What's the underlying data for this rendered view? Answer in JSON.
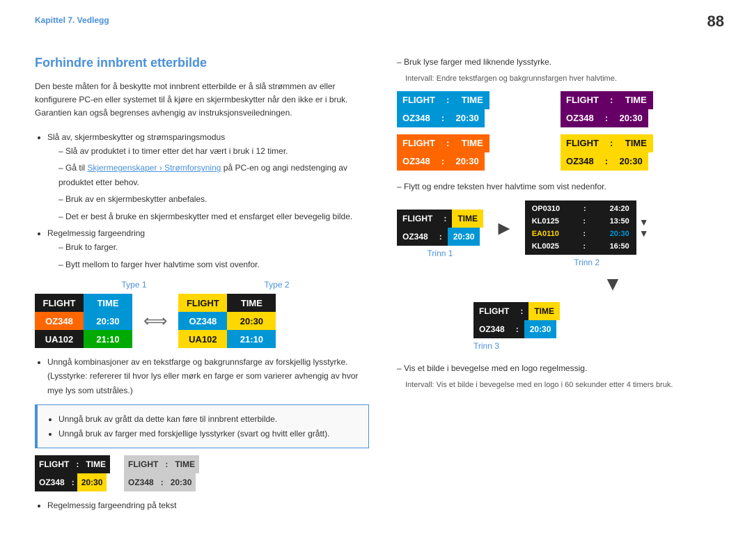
{
  "page": {
    "number": "88",
    "chapter": "Kapittel 7. Vedlegg"
  },
  "section": {
    "title": "Forhindre innbrent etterbilde",
    "intro": "Den beste måten for å beskytte mot innbrent etterbilde er å slå strømmen av eller konfigurere PC-en eller systemet til å kjøre en skjermbeskytter når den ikke er i bruk. Garantien kan også begrenses avhengig av instruksjonsveiledningen.",
    "bullets": [
      {
        "text": "Slå av, skjermbeskytter og strømsparingsmodus",
        "sub": [
          "Slå av produktet i to timer etter det har vært i bruk i 12 timer.",
          "Gå til Skjermegenskaper > Strømforsyning på PC-en og angi nedstenging av produktet etter behov.",
          "Bruk av en skjermbeskytter anbefales.",
          "Det er best å bruke en skjermbeskytter med et ensfarget eller bevegelig bilde."
        ]
      },
      {
        "text": "Regelmessig fargeendring",
        "sub": [
          "Bruk to farger.",
          "Bytt mellom to farger hver halvtime som vist ovenfor."
        ]
      }
    ],
    "type1_label": "Type 1",
    "type2_label": "Type 2",
    "board1": {
      "row1": [
        {
          "text": "FLIGHT",
          "cls": "c-black"
        },
        {
          "text": "TIME",
          "cls": "c-blue"
        }
      ],
      "row2": [
        {
          "text": "OZ348",
          "cls": "c-orange"
        },
        {
          "text": "20:30",
          "cls": "c-blue"
        }
      ],
      "row3": [
        {
          "text": "UA102",
          "cls": "c-black"
        },
        {
          "text": "21:10",
          "cls": "c-green"
        }
      ]
    },
    "board2": {
      "row1": [
        {
          "text": "FLIGHT",
          "cls": "c-yellow"
        },
        {
          "text": "TIME",
          "cls": "c-black"
        }
      ],
      "row2": [
        {
          "text": "OZ348",
          "cls": "c-blue"
        },
        {
          "text": "20:30",
          "cls": "c-yellow"
        }
      ],
      "row3": [
        {
          "text": "UA102",
          "cls": "c-yellow"
        },
        {
          "text": "21:10",
          "cls": "c-blue"
        }
      ]
    },
    "avoid_text": "Unngå kombinasjoner av en tekstfarge og bakgrunnsfarge av forskjellig lysstyrke. (Lysstyrke: refererer til hvor lys eller mørk en farge er som varierer avhengig av hvor mye lys som utstråles.)",
    "info_bullets": [
      "Unngå bruk av grått da dette kan føre til innbrent etterbilde.",
      "Unngå bruk av farger med forskjellige lysstyrker (svart og hvitt eller grått)."
    ],
    "bad1": {
      "label": "",
      "row1": [
        {
          "text": "FLIGHT",
          "cls": "c-black"
        },
        {
          "text": ":",
          "cls": "c-black"
        },
        {
          "text": "TIME",
          "cls": "c-black"
        }
      ],
      "row2": [
        {
          "text": "OZ348",
          "cls": "c-black"
        },
        {
          "text": ":",
          "cls": "c-black"
        },
        {
          "text": "20:30",
          "cls": "c-yellow"
        }
      ]
    },
    "bad2": {
      "label": "",
      "row1": [
        {
          "text": "FLIGHT",
          "cls": "c-lightgray"
        },
        {
          "text": ":",
          "cls": "c-lightgray"
        },
        {
          "text": "TIME",
          "cls": "c-lightgray"
        }
      ],
      "row2": [
        {
          "text": "OZ348",
          "cls": "c-lightgray"
        },
        {
          "text": ":",
          "cls": "c-lightgray"
        },
        {
          "text": "20:30",
          "cls": "c-lightgray"
        }
      ]
    },
    "bottom_bullet": "Regelmessig fargeendring på tekst"
  },
  "right": {
    "note1_dash": "Bruk lyse farger med liknende lysstyrke.",
    "note1_sub": "Intervall: Endre tekstfargen og bakgrunnsfargen hver halvtime.",
    "color_boards": [
      {
        "row1": [
          {
            "text": "FLIGHT",
            "cls": "c-blue"
          },
          {
            "text": ":",
            "cls": "c-blue"
          },
          {
            "text": "TIME",
            "cls": "c-blue"
          }
        ],
        "row2": [
          {
            "text": "OZ348",
            "cls": "c-blue"
          },
          {
            "text": ":",
            "cls": "c-blue"
          },
          {
            "text": "20:30",
            "cls": "c-blue"
          }
        ]
      },
      {
        "row1": [
          {
            "text": "FLIGHT",
            "cls": "c-purple"
          },
          {
            "text": ":",
            "cls": "c-purple"
          },
          {
            "text": "TIME",
            "cls": "c-purple"
          }
        ],
        "row2": [
          {
            "text": "OZ348",
            "cls": "c-purple"
          },
          {
            "text": ":",
            "cls": "c-purple"
          },
          {
            "text": "20:30",
            "cls": "c-purple"
          }
        ]
      },
      {
        "row1": [
          {
            "text": "FLIGHT",
            "cls": "c-orange"
          },
          {
            "text": ":",
            "cls": "c-orange"
          },
          {
            "text": "TIME",
            "cls": "c-orange"
          }
        ],
        "row2": [
          {
            "text": "OZ348",
            "cls": "c-orange"
          },
          {
            "text": ":",
            "cls": "c-orange"
          },
          {
            "text": "20:30",
            "cls": "c-orange"
          }
        ]
      },
      {
        "row1": [
          {
            "text": "FLIGHT",
            "cls": "c-yellow"
          },
          {
            "text": ":",
            "cls": "c-yellow"
          },
          {
            "text": "TIME",
            "cls": "c-yellow"
          }
        ],
        "row2": [
          {
            "text": "OZ348",
            "cls": "c-yellow"
          },
          {
            "text": ":",
            "cls": "c-yellow"
          },
          {
            "text": "20:30",
            "cls": "c-yellow"
          }
        ]
      }
    ],
    "note2_dash": "Flytt og endre teksten hver halvtime som vist nedenfor.",
    "trinn1_label": "Trinn 1",
    "trinn2_label": "Trinn 2",
    "trinn3_label": "Trinn 3",
    "trinn1_board": {
      "row1": [
        {
          "text": "FLIGHT",
          "cls": "c-black"
        },
        {
          "text": ":",
          "cls": "c-black"
        },
        {
          "text": "TIME",
          "cls": "c-yellow"
        }
      ],
      "row2": [
        {
          "text": "OZ348",
          "cls": "c-black"
        },
        {
          "text": ":",
          "cls": "c-black"
        },
        {
          "text": "20:30",
          "cls": "c-blue"
        }
      ]
    },
    "trinn2_scroll": [
      {
        "text": "OP0310 : 24:20",
        "hl": false
      },
      {
        "text": "KL0125 : 13:50",
        "hl": false
      },
      {
        "text": "EA0110 : 20:30",
        "hl": true
      },
      {
        "text": "KL0025 : 16:50",
        "hl": false
      }
    ],
    "trinn3_board": {
      "row1": [
        {
          "text": "FLIGHT",
          "cls": "c-black"
        },
        {
          "text": ":",
          "cls": "c-black"
        },
        {
          "text": "TIME",
          "cls": "c-yellow"
        }
      ],
      "row2": [
        {
          "text": "OZ348",
          "cls": "c-black"
        },
        {
          "text": ":",
          "cls": "c-black"
        },
        {
          "text": "20:30",
          "cls": "c-blue"
        }
      ]
    },
    "note3_dash": "Vis et bilde i bevegelse med en logo regelmessig.",
    "note3_sub": "Intervall: Vis et bilde i bevegelse med en logo i 60 sekunder etter 4 timers bruk."
  }
}
